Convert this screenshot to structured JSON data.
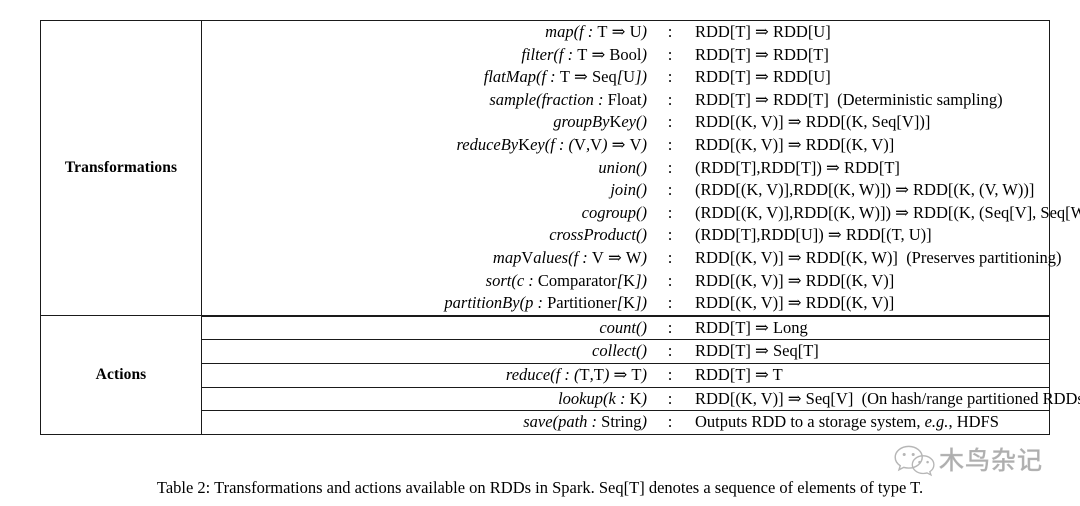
{
  "table": {
    "sections": [
      {
        "label": "Transformations",
        "rows": [
          {
            "signature": "map(f : T ⇒ U)",
            "colon": ":",
            "type": "RDD[T] ⇒ RDD[U]"
          },
          {
            "signature": "filter(f : T ⇒ Bool)",
            "colon": ":",
            "type": "RDD[T] ⇒ RDD[T]"
          },
          {
            "signature": "flatMap(f : T ⇒ Seq[U])",
            "colon": ":",
            "type": "RDD[T] ⇒ RDD[U]"
          },
          {
            "signature": "sample(fraction : Float)",
            "colon": ":",
            "type": "RDD[T] ⇒ RDD[T]",
            "note": "(Deterministic sampling)"
          },
          {
            "signature": "groupByKey()",
            "colon": ":",
            "type": "RDD[(K, V)] ⇒ RDD[(K, Seq[V])]"
          },
          {
            "signature": "reduceByKey(f : (V,V) ⇒ V)",
            "colon": ":",
            "type": "RDD[(K, V)] ⇒ RDD[(K, V)]"
          },
          {
            "signature": "union()",
            "colon": ":",
            "type": "(RDD[T],RDD[T]) ⇒ RDD[T]"
          },
          {
            "signature": "join()",
            "colon": ":",
            "type": "(RDD[(K, V)],RDD[(K, W)]) ⇒ RDD[(K, (V, W))]"
          },
          {
            "signature": "cogroup()",
            "colon": ":",
            "type": "(RDD[(K, V)],RDD[(K, W)]) ⇒ RDD[(K, (Seq[V], Seq[W]))]"
          },
          {
            "signature": "crossProduct()",
            "colon": ":",
            "type": "(RDD[T],RDD[U]) ⇒ RDD[(T, U)]"
          },
          {
            "signature": "mapValues(f : V ⇒ W)",
            "colon": ":",
            "type": "RDD[(K, V)] ⇒ RDD[(K, W)]",
            "note": "(Preserves partitioning)"
          },
          {
            "signature": "sort(c : Comparator[K])",
            "colon": ":",
            "type": "RDD[(K, V)] ⇒ RDD[(K, V)]"
          },
          {
            "signature": "partitionBy(p : Partitioner[K])",
            "colon": ":",
            "type": "RDD[(K, V)] ⇒ RDD[(K, V)]"
          }
        ]
      },
      {
        "label": "Actions",
        "rows": [
          {
            "signature": "count()",
            "colon": ":",
            "type": "RDD[T] ⇒ Long"
          },
          {
            "signature": "collect()",
            "colon": ":",
            "type": "RDD[T] ⇒ Seq[T]"
          },
          {
            "signature": "reduce(f : (T,T) ⇒ T)",
            "colon": ":",
            "type": "RDD[T] ⇒ T"
          },
          {
            "signature": "lookup(k : K)",
            "colon": ":",
            "type": "RDD[(K, V)] ⇒ Seq[V]",
            "note": "(On hash/range partitioned RDDs)"
          },
          {
            "signature": "save(path : String)",
            "colon": ":",
            "type": "Outputs RDD to a storage system, e.g., HDFS"
          }
        ]
      }
    ]
  },
  "caption": "Table 2: Transformations and actions available on RDDs in Spark. Seq[T] denotes a sequence of elements of type T.",
  "watermark": {
    "text": "木鸟杂记",
    "logo": "wechat-icon"
  }
}
